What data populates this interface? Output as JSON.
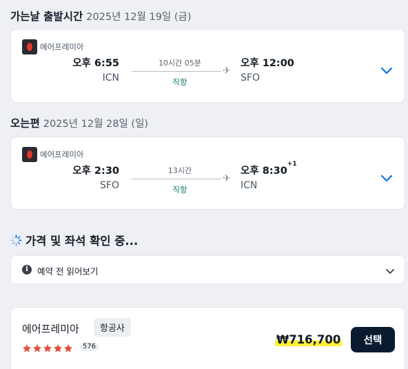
{
  "outbound": {
    "title": "가는날 출발시간",
    "date": "2025년 12월 19일 (금)",
    "airline": "에어프레미아",
    "dep_time": "오후 6:55",
    "dep_code": "ICN",
    "duration": "10시간 05분",
    "stops": "직항",
    "arr_time": "오후 12:00",
    "arr_code": "SFO",
    "arr_day_offset": ""
  },
  "inbound": {
    "title": "오는편",
    "date": "2025년 12월 28일 (일)",
    "airline": "에어프레미아",
    "dep_time": "오후 2:30",
    "dep_code": "SFO",
    "duration": "13시간",
    "stops": "직항",
    "arr_time": "오후 8:30",
    "arr_code": "ICN",
    "arr_day_offset": "+1"
  },
  "loading_text": "가격 및 좌석 확인 중...",
  "notice": {
    "label": "예약 전 읽어보기"
  },
  "offer": {
    "provider": "에어프레미아",
    "tag": "항공사",
    "rating": 5,
    "review_count": "576",
    "price": "₩716,700",
    "select_label": "선택"
  },
  "colors": {
    "accent": "#0770e3",
    "direct": "#147a6c",
    "button": "#0b1b2f",
    "star": "#e1513b",
    "highlight": "#ffef3a"
  },
  "icons": {
    "plane": "plane-icon",
    "expand": "chevron-down-icon",
    "info": "info-icon",
    "spinner": "loading-spinner-icon",
    "star": "star-icon"
  }
}
